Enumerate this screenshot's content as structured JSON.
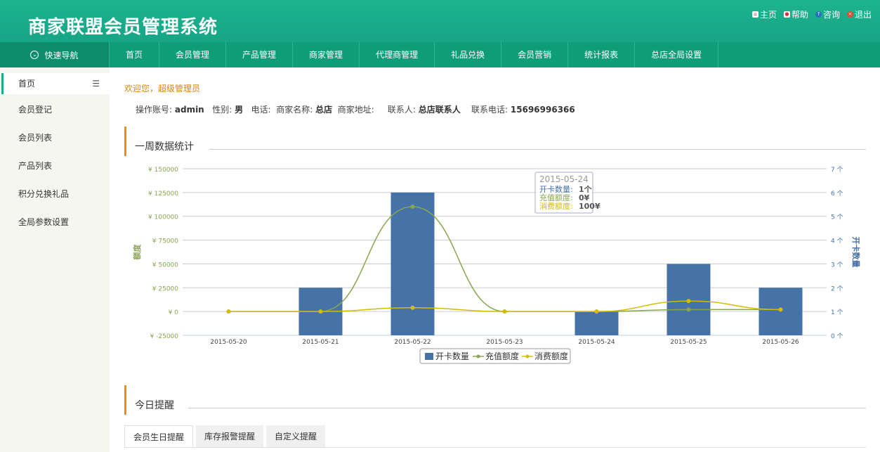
{
  "header": {
    "title": "商家联盟会员管理系统",
    "links": [
      {
        "label": "主页",
        "icon": "home-icon"
      },
      {
        "label": "帮助",
        "icon": "help-person-icon"
      },
      {
        "label": "咨询",
        "icon": "question-icon"
      },
      {
        "label": "退出",
        "icon": "exit-icon"
      }
    ]
  },
  "nav": {
    "quick": "快速导航",
    "items": [
      "首页",
      "会员管理",
      "产品管理",
      "商家管理",
      "代理商管理",
      "礼品兑换",
      "会员营销",
      "统计报表",
      "总店全局设置"
    ]
  },
  "sidebar": {
    "items": [
      "首页",
      "会员登记",
      "会员列表",
      "产品列表",
      "积分兑换礼品",
      "全局参数设置"
    ]
  },
  "main": {
    "welcome": "欢迎您，超级管理员",
    "info": {
      "account_label": "操作账号:",
      "account": "admin",
      "gender_label": "性别:",
      "gender": "男",
      "phone_label": "电话:",
      "shop_label": "商家名称:",
      "shop": "总店",
      "address_label": "商家地址:",
      "contact_label": "联系人:",
      "contact": "总店联系人",
      "contact_phone_label": "联系电话:",
      "contact_phone": "15696996366"
    },
    "section1": "一周数据统计",
    "section2": "今日提醒",
    "tabs": [
      "会员生日提醒",
      "库存报警提醒",
      "自定义提醒"
    ]
  },
  "chart_data": {
    "type": "bar",
    "categories": [
      "2015-05-20",
      "2015-05-21",
      "2015-05-22",
      "2015-05-23",
      "2015-05-24",
      "2015-05-25",
      "2015-05-26"
    ],
    "y_left": {
      "label": "额度",
      "ticks": [
        "¥ 150000",
        "¥ 125000",
        "¥ 100000",
        "¥ 75000",
        "¥ 50000",
        "¥ 25000",
        "¥ 0",
        "¥ -25000"
      ],
      "range": [
        -25000,
        150000
      ]
    },
    "y_right": {
      "label": "开卡数量",
      "ticks": [
        "7 个",
        "6 个",
        "5 个",
        "4 个",
        "3 个",
        "2 个",
        "1 个",
        "0 个"
      ],
      "range": [
        0,
        7
      ]
    },
    "series": [
      {
        "name": "开卡数量",
        "type": "bar",
        "axis": "right",
        "values": [
          0,
          2,
          6,
          0,
          1,
          3,
          2
        ]
      },
      {
        "name": "充值额度",
        "type": "line",
        "axis": "left",
        "values": [
          0,
          0,
          110000,
          0,
          0,
          2000,
          2000
        ]
      },
      {
        "name": "消费额度",
        "type": "line",
        "axis": "left",
        "values": [
          0,
          0,
          4000,
          0,
          0,
          11000,
          2000
        ]
      }
    ],
    "colors": {
      "bar": "#4572a7",
      "recharge": "#89a54e",
      "consume": "#d4bd00"
    },
    "tooltip": {
      "date": "2015-05-24",
      "rows": [
        {
          "label": "开卡数量",
          "value": "1个"
        },
        {
          "label": "充值额度",
          "value": "0¥"
        },
        {
          "label": "消费额度",
          "value": "100¥"
        }
      ]
    }
  }
}
